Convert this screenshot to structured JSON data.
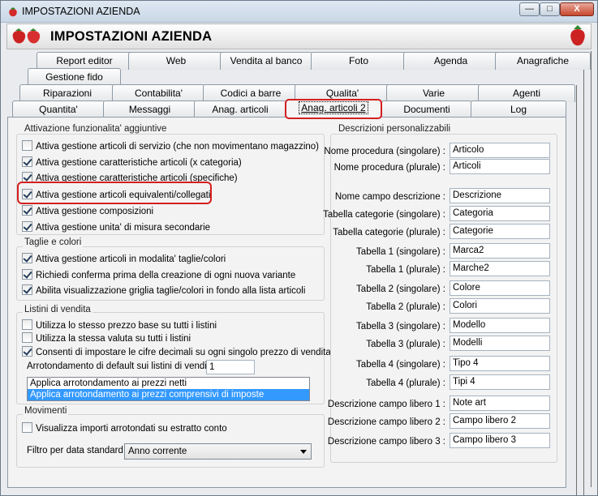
{
  "window": {
    "title": "IMPOSTAZIONI AZIENDA",
    "header_title": "IMPOSTAZIONI AZIENDA",
    "buttons": {
      "minimize": "—",
      "maximize": "□",
      "close": "X"
    },
    "colors": {
      "highlight": "#d41f1f",
      "selection": "#3399ff"
    }
  },
  "tabs": {
    "row1": [
      "Report editor",
      "Web",
      "Vendita al banco",
      "Foto",
      "Agenda",
      "Anagrafiche"
    ],
    "row2": [
      "Gestione fido"
    ],
    "row3": [
      "Riparazioni",
      "Contabilita'",
      "Codici a barre",
      "Qualita'",
      "Varie",
      "Agenti"
    ],
    "row4": [
      "Quantita'",
      "Messaggi",
      "Anag. articoli",
      "Anag. articoli 2",
      "Documenti",
      "Log"
    ],
    "selected": "Anag. articoli 2"
  },
  "groups": {
    "attivazione": {
      "title": "Attivazione funzionalita' aggiuntive",
      "items": [
        {
          "label": "Attiva gestione articoli di servizio (che non movimentano magazzino)",
          "checked": false
        },
        {
          "label": "Attiva gestione caratteristiche articoli (x categoria)",
          "checked": true
        },
        {
          "label": "Attiva gestione caratteristiche articoli (specifiche)",
          "checked": true
        },
        {
          "label": "Attiva gestione articoli equivalenti/collegati",
          "checked": true
        },
        {
          "label": "Attiva gestione composizioni",
          "checked": true
        },
        {
          "label": "Attiva gestione unita' di misura secondarie",
          "checked": true
        }
      ]
    },
    "taglie": {
      "title": "Taglie e colori",
      "items": [
        {
          "label": "Attiva gestione articoli in modalita' taglie/colori",
          "checked": true
        },
        {
          "label": "Richiedi conferma prima della creazione di ogni nuova variante",
          "checked": true
        },
        {
          "label": "Abilita visualizzazione griglia taglie/colori in fondo alla lista articoli",
          "checked": true
        }
      ]
    },
    "listini": {
      "title": "Listini di vendita",
      "items": [
        {
          "label": "Utilizza lo stesso prezzo base su tutti i listini",
          "checked": false
        },
        {
          "label": "Utilizza la stessa valuta su tutti i listini",
          "checked": false
        },
        {
          "label": "Consenti di impostare le cifre decimali su ogni singolo prezzo di vendita",
          "checked": true
        }
      ],
      "rounding_label": "Arrotondamento di default sui listini di vendita :",
      "rounding_value": "1",
      "rounding_options": [
        "Applica arrotondamento ai prezzi netti",
        "Applica arrotondamento ai prezzi comprensivi di imposte"
      ]
    },
    "movimenti": {
      "title": "Movimenti",
      "items": [
        {
          "label": "Visualizza importi arrotondati su estratto conto",
          "checked": false
        }
      ],
      "filter_label": "Filtro per data standard :",
      "filter_value": "Anno corrente"
    },
    "descrizioni": {
      "title": "Descrizioni personalizzabili",
      "fields": [
        {
          "label": "Nome procedura (singolare) :",
          "value": "Articolo"
        },
        {
          "label": "Nome procedura (plurale) :",
          "value": "Articoli"
        },
        {
          "label": "Nome campo descrizione :",
          "value": "Descrizione"
        },
        {
          "label": "Tabella categorie (singolare) :",
          "value": "Categoria"
        },
        {
          "label": "Tabella categorie (plurale) :",
          "value": "Categorie"
        },
        {
          "label": "Tabella 1 (singolare) :",
          "value": "Marca2"
        },
        {
          "label": "Tabella 1 (plurale) :",
          "value": "Marche2"
        },
        {
          "label": "Tabella 2 (singolare) :",
          "value": "Colore"
        },
        {
          "label": "Tabella 2 (plurale) :",
          "value": "Colori"
        },
        {
          "label": "Tabella 3 (singolare) :",
          "value": "Modello"
        },
        {
          "label": "Tabella 3 (plurale) :",
          "value": "Modelli"
        },
        {
          "label": "Tabella 4 (singolare) :",
          "value": "Tipo 4"
        },
        {
          "label": "Tabella 4 (plurale) :",
          "value": "Tipi 4"
        },
        {
          "label": "Descrizione campo libero 1 :",
          "value": "Note art"
        },
        {
          "label": "Descrizione campo libero 2 :",
          "value": "Campo libero 2"
        },
        {
          "label": "Descrizione campo libero 3 :",
          "value": "Campo libero 3"
        }
      ]
    }
  }
}
